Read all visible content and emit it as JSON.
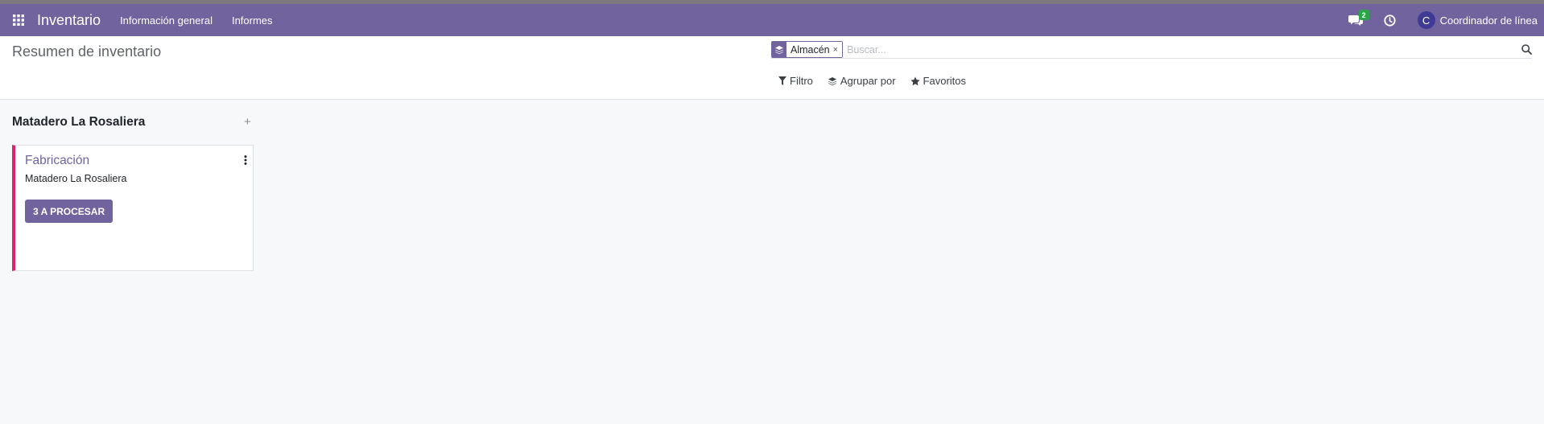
{
  "navbar": {
    "apps_icon": "apps-grid-icon",
    "brand": "Inventario",
    "menu": [
      {
        "label": "Información general"
      },
      {
        "label": "Informes"
      }
    ],
    "messages_badge": "2",
    "user_initial": "C",
    "user_name": "Coordinador de línea"
  },
  "control_panel": {
    "title": "Resumen de inventario",
    "search": {
      "facet_value": "Almacén",
      "facet_remove": "×",
      "placeholder": "Buscar..."
    },
    "filters": {
      "filter_label": "Filtro",
      "groupby_label": "Agrupar por",
      "favorites_label": "Favoritos"
    }
  },
  "kanban": {
    "column_title": "Matadero La Rosaliera",
    "column_add": "+",
    "cards": [
      {
        "title": "Fabricación",
        "subtitle": "Matadero La Rosaliera",
        "button_label": "3 A PROCESAR"
      }
    ]
  },
  "colors": {
    "brand": "#71639e",
    "card_accent": "#e3206e",
    "badge": "#28a745",
    "avatar": "#3f3a96"
  }
}
